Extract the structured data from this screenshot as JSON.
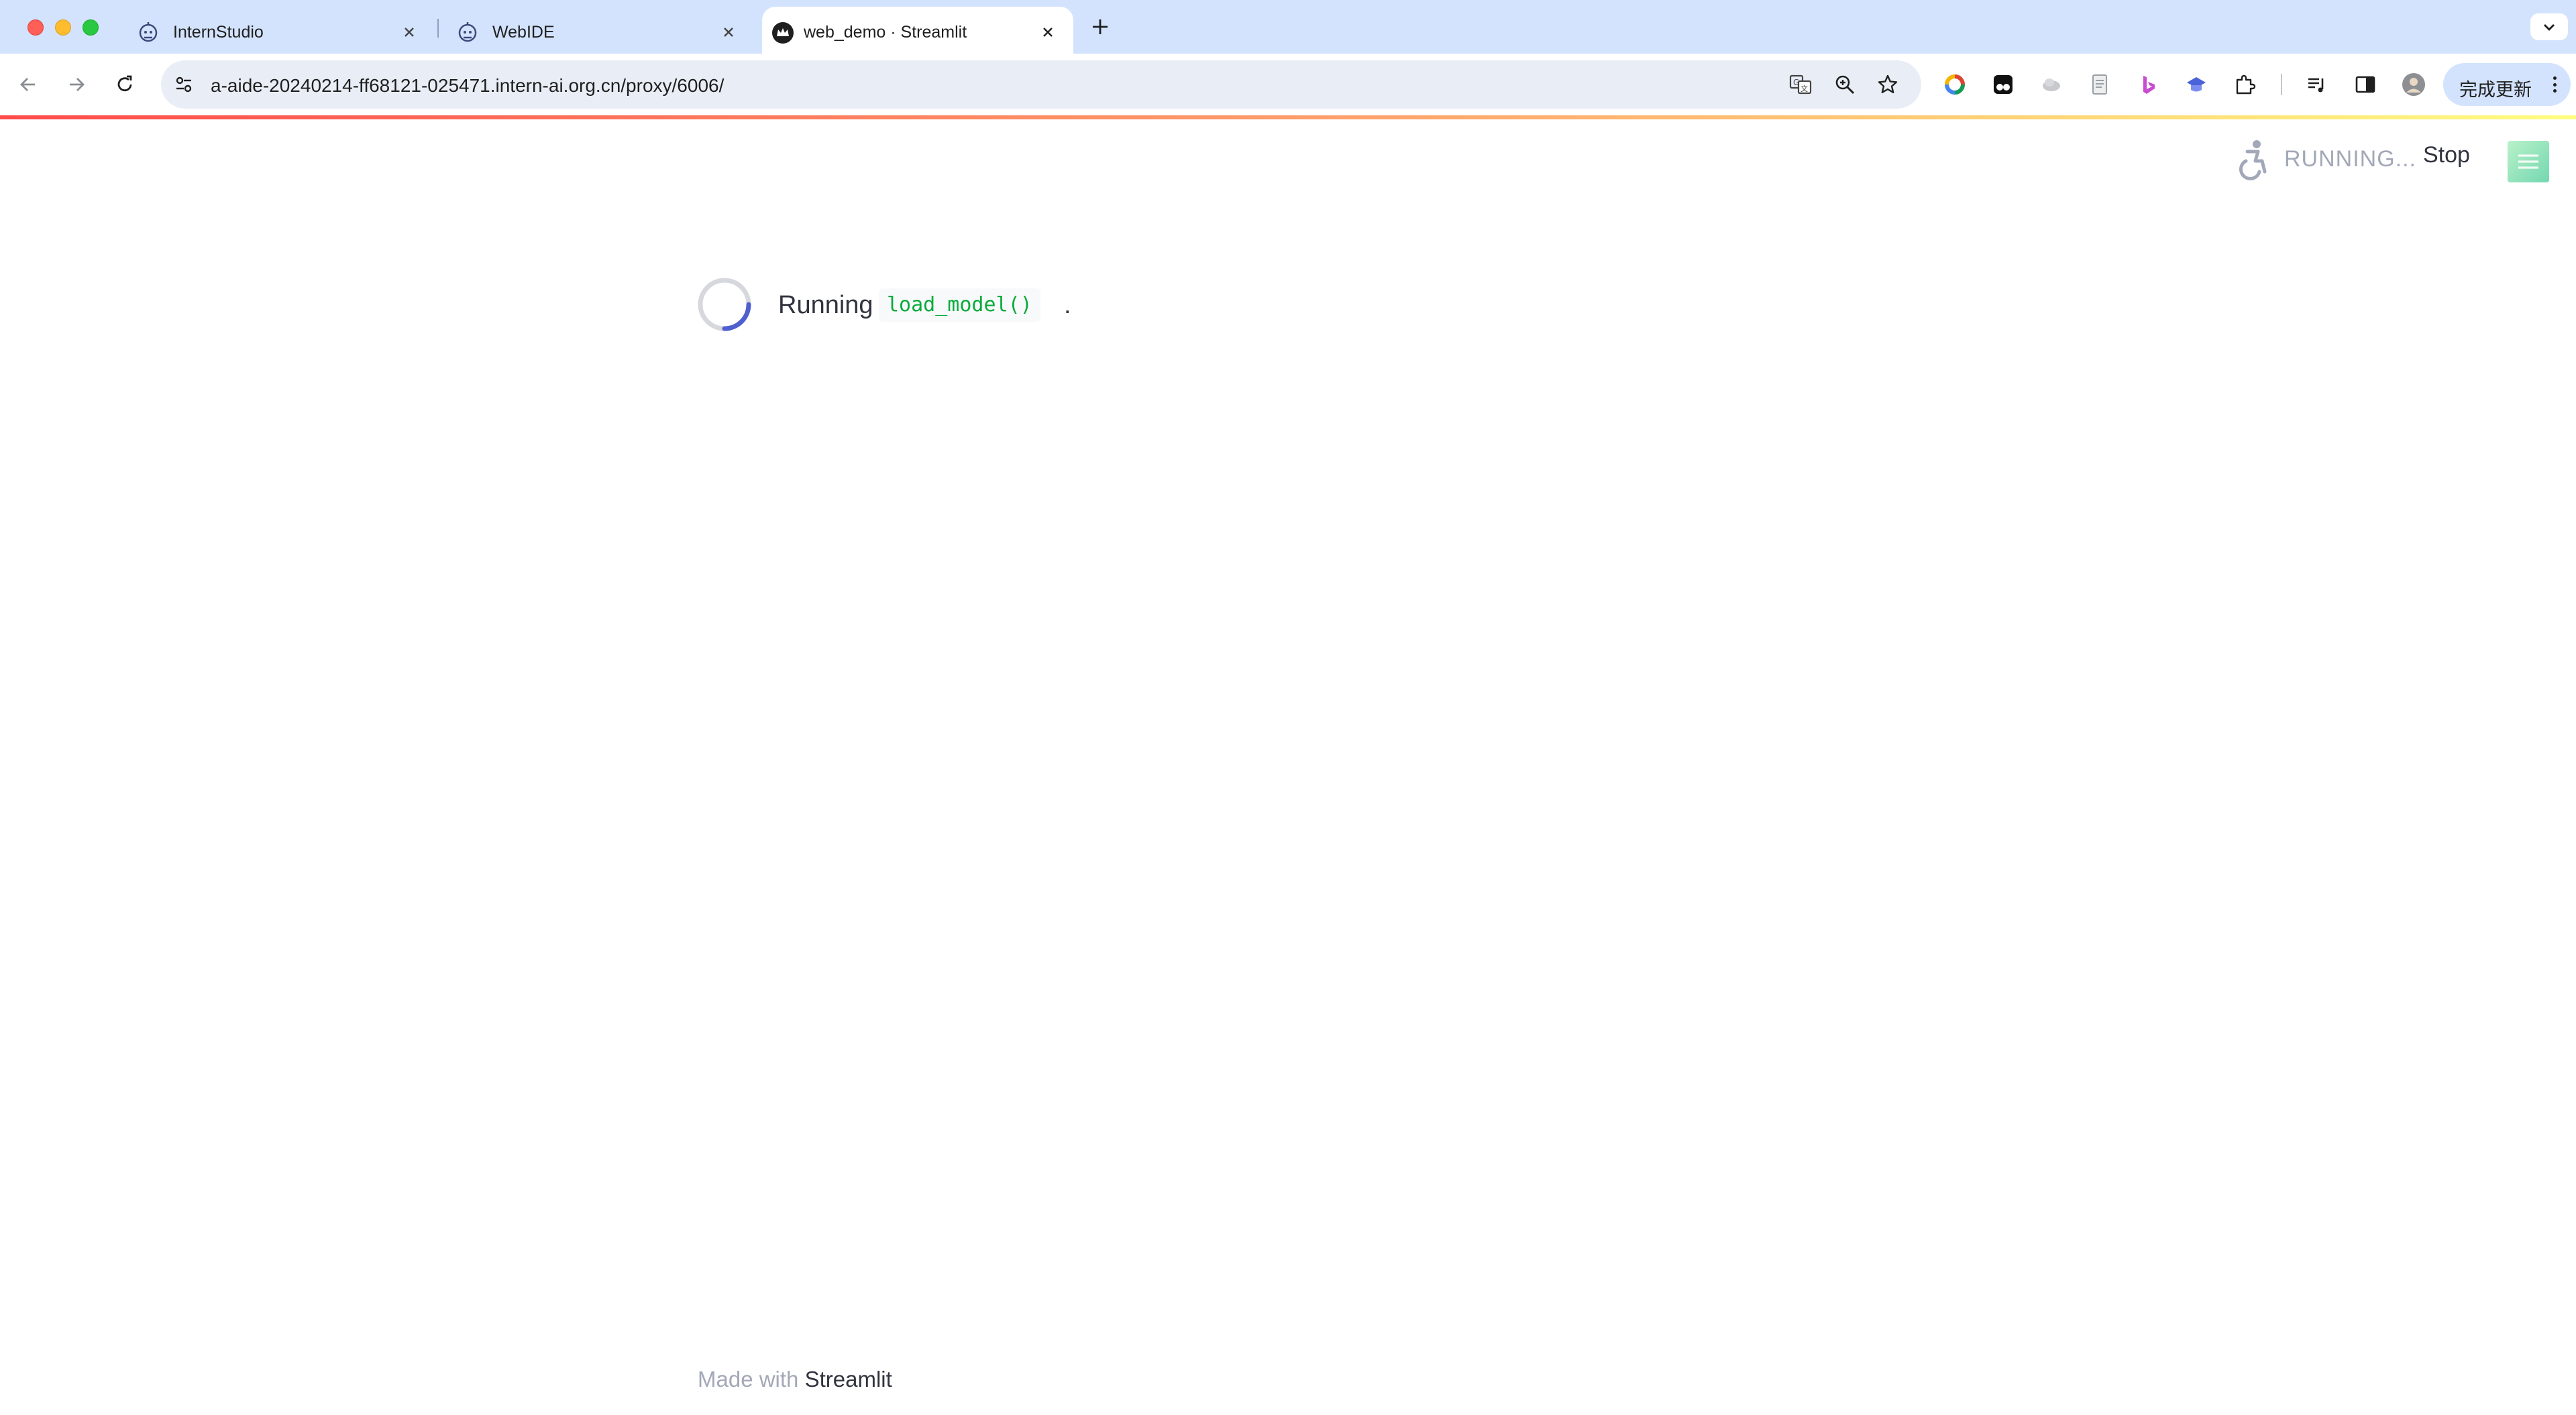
{
  "browser": {
    "tabs": [
      {
        "title": "InternStudio",
        "favicon": "robot-favicon"
      },
      {
        "title": "WebIDE",
        "favicon": "robot-favicon"
      },
      {
        "title": "web_demo · Streamlit",
        "favicon": "streamlit-crown-favicon",
        "active": true
      }
    ],
    "url": "a-aide-20240214-ff68121-025471.intern-ai.org.cn/proxy/6006/",
    "update_button_label": "完成更新",
    "toolbar_icons": [
      "back-icon",
      "forward-icon",
      "reload-icon",
      "site-info-icon",
      "translate-icon",
      "zoom-icon",
      "bookmark-star-icon"
    ],
    "extension_icons": [
      "color-ring-extension-icon",
      "tampermonkey-extension-icon",
      "cloud-extension-icon",
      "document-extension-icon",
      "bing-extension-icon",
      "graduation-cap-extension-icon",
      "puzzle-extensions-icon",
      "reading-list-icon",
      "side-panel-icon",
      "profile-avatar-icon"
    ]
  },
  "streamlit": {
    "status_text": "RUNNING...",
    "stop_label": "Stop",
    "running_label": "Running",
    "function_name": "load_model()",
    "period": ".",
    "footer_prefix": "Made with",
    "footer_brand": "Streamlit",
    "colors": {
      "decoration_start": "#ff4b4b",
      "decoration_end": "#fffd80",
      "spinner_accent": "#4f5fcf",
      "code_text": "#09ab3b",
      "muted_text": "#a3a8b8",
      "body_text": "#31333f"
    }
  }
}
